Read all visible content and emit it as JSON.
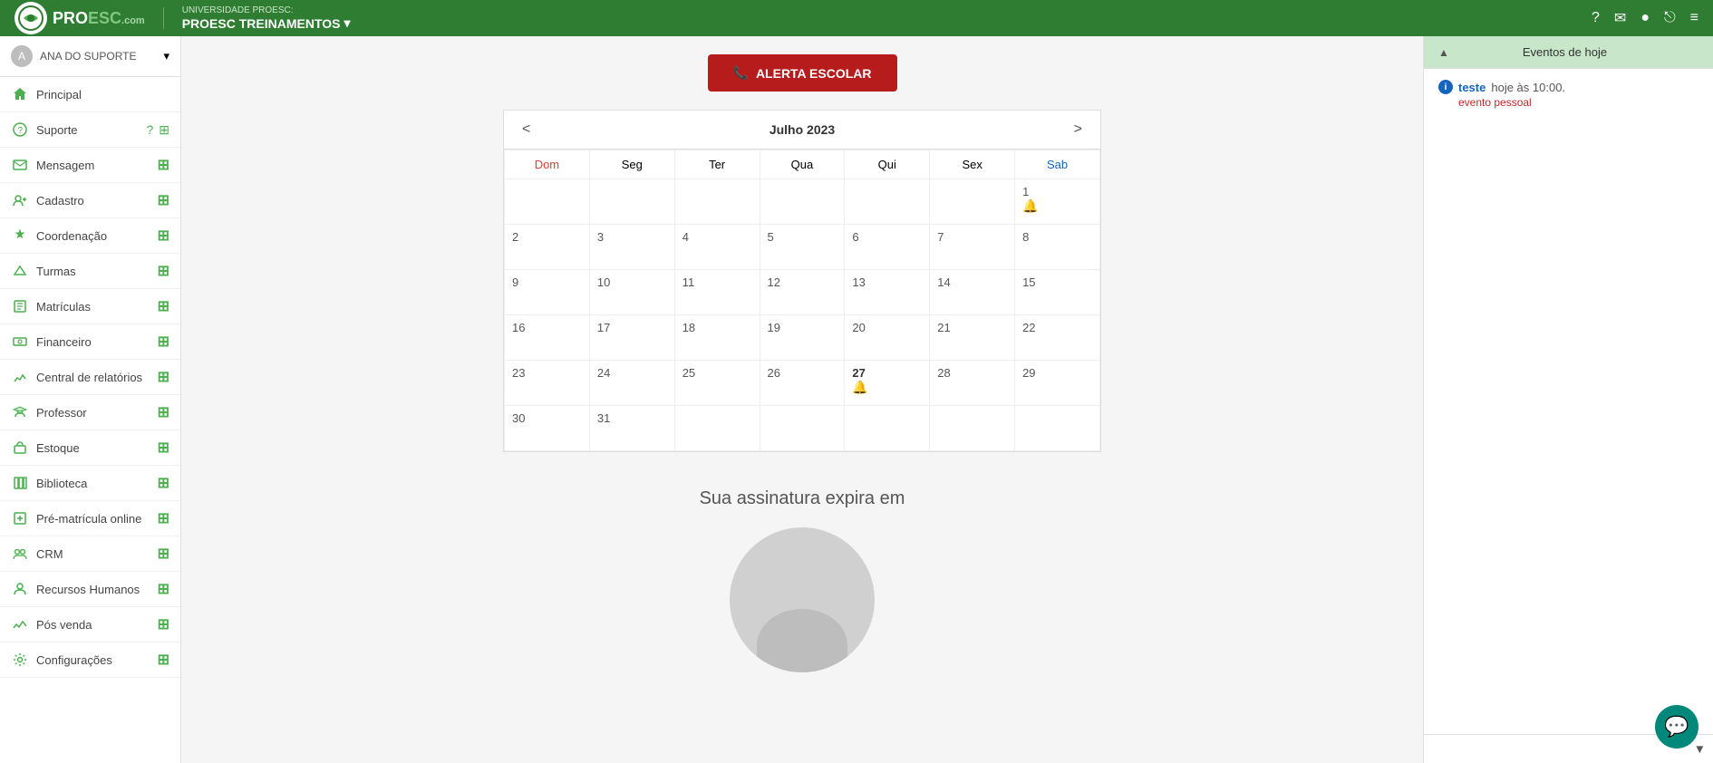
{
  "topbar": {
    "logo_text": "PRO",
    "logo_text2": "ESC",
    "logo_sub": ".com",
    "school_sub": "UNIVERSIDADE PROESC:",
    "school_name": "PROESC TREINAMENTOS",
    "chevron": "▾",
    "icons": [
      "?",
      "✉",
      "👤",
      "⎋",
      "≡"
    ]
  },
  "sidebar": {
    "user_name": "ANA DO SUPORTE",
    "user_chevron": "▾",
    "items": [
      {
        "id": "principal",
        "label": "Principal",
        "icon": "🏠",
        "has_add": false
      },
      {
        "id": "suporte",
        "label": "Suporte",
        "icon": null,
        "has_add": true,
        "is_support": true
      },
      {
        "id": "mensagem",
        "label": "Mensagem",
        "icon": "✉",
        "has_add": true
      },
      {
        "id": "cadastro",
        "label": "Cadastro",
        "icon": "👥",
        "has_add": true
      },
      {
        "id": "coordenacao",
        "label": "Coordenação",
        "icon": "🎓",
        "has_add": true
      },
      {
        "id": "turmas",
        "label": "Turmas",
        "icon": "✏️",
        "has_add": true
      },
      {
        "id": "matriculas",
        "label": "Matrículas",
        "icon": "📋",
        "has_add": true
      },
      {
        "id": "financeiro",
        "label": "Financeiro",
        "icon": "💰",
        "has_add": true
      },
      {
        "id": "relatorios",
        "label": "Central de relatórios",
        "icon": "📊",
        "has_add": true
      },
      {
        "id": "professor",
        "label": "Professor",
        "icon": "🎓",
        "has_add": true
      },
      {
        "id": "estoque",
        "label": "Estoque",
        "icon": "📦",
        "has_add": true
      },
      {
        "id": "biblioteca",
        "label": "Biblioteca",
        "icon": "📚",
        "has_add": true
      },
      {
        "id": "pre-matricula",
        "label": "Pré-matrícula online",
        "icon": "📝",
        "has_add": true
      },
      {
        "id": "crm",
        "label": "CRM",
        "icon": "👥",
        "has_add": true
      },
      {
        "id": "rh",
        "label": "Recursos Humanos",
        "icon": "👤",
        "has_add": true
      },
      {
        "id": "pos-venda",
        "label": "Pós venda",
        "icon": "📈",
        "has_add": true
      },
      {
        "id": "configuracoes",
        "label": "Configurações",
        "icon": "⚙️",
        "has_add": true
      }
    ]
  },
  "calendar": {
    "title": "Julho 2023",
    "prev": "<",
    "next": ">",
    "weekdays": [
      {
        "label": "Dom",
        "class": "dom"
      },
      {
        "label": "Seg",
        "class": ""
      },
      {
        "label": "Ter",
        "class": ""
      },
      {
        "label": "Qua",
        "class": ""
      },
      {
        "label": "Qui",
        "class": ""
      },
      {
        "label": "Sex",
        "class": ""
      },
      {
        "label": "Sab",
        "class": "sab"
      }
    ],
    "weeks": [
      [
        "",
        "",
        "",
        "",
        "",
        "",
        "1"
      ],
      [
        "2",
        "3",
        "4",
        "5",
        "6",
        "7",
        "8"
      ],
      [
        "9",
        "10",
        "11",
        "12",
        "13",
        "14",
        "15"
      ],
      [
        "16",
        "17",
        "18",
        "19",
        "20",
        "21",
        "22"
      ],
      [
        "23",
        "24",
        "25",
        "26",
        "27",
        "28",
        "29"
      ],
      [
        "30",
        "31",
        "",
        "",
        "",
        "",
        ""
      ]
    ],
    "bell_days": [
      "1",
      "27"
    ],
    "bold_days": [
      "27"
    ]
  },
  "subscription": {
    "text": "Sua assinatura expira em"
  },
  "alert_button": {
    "label": "ALERTA ESCOLAR",
    "icon": "📞"
  },
  "events_panel": {
    "header": "Eventos de hoje",
    "events": [
      {
        "name": "teste",
        "time": "hoje às 10:00.",
        "tag": "evento pessoal"
      }
    ]
  },
  "chat": {
    "icon": "💬"
  }
}
